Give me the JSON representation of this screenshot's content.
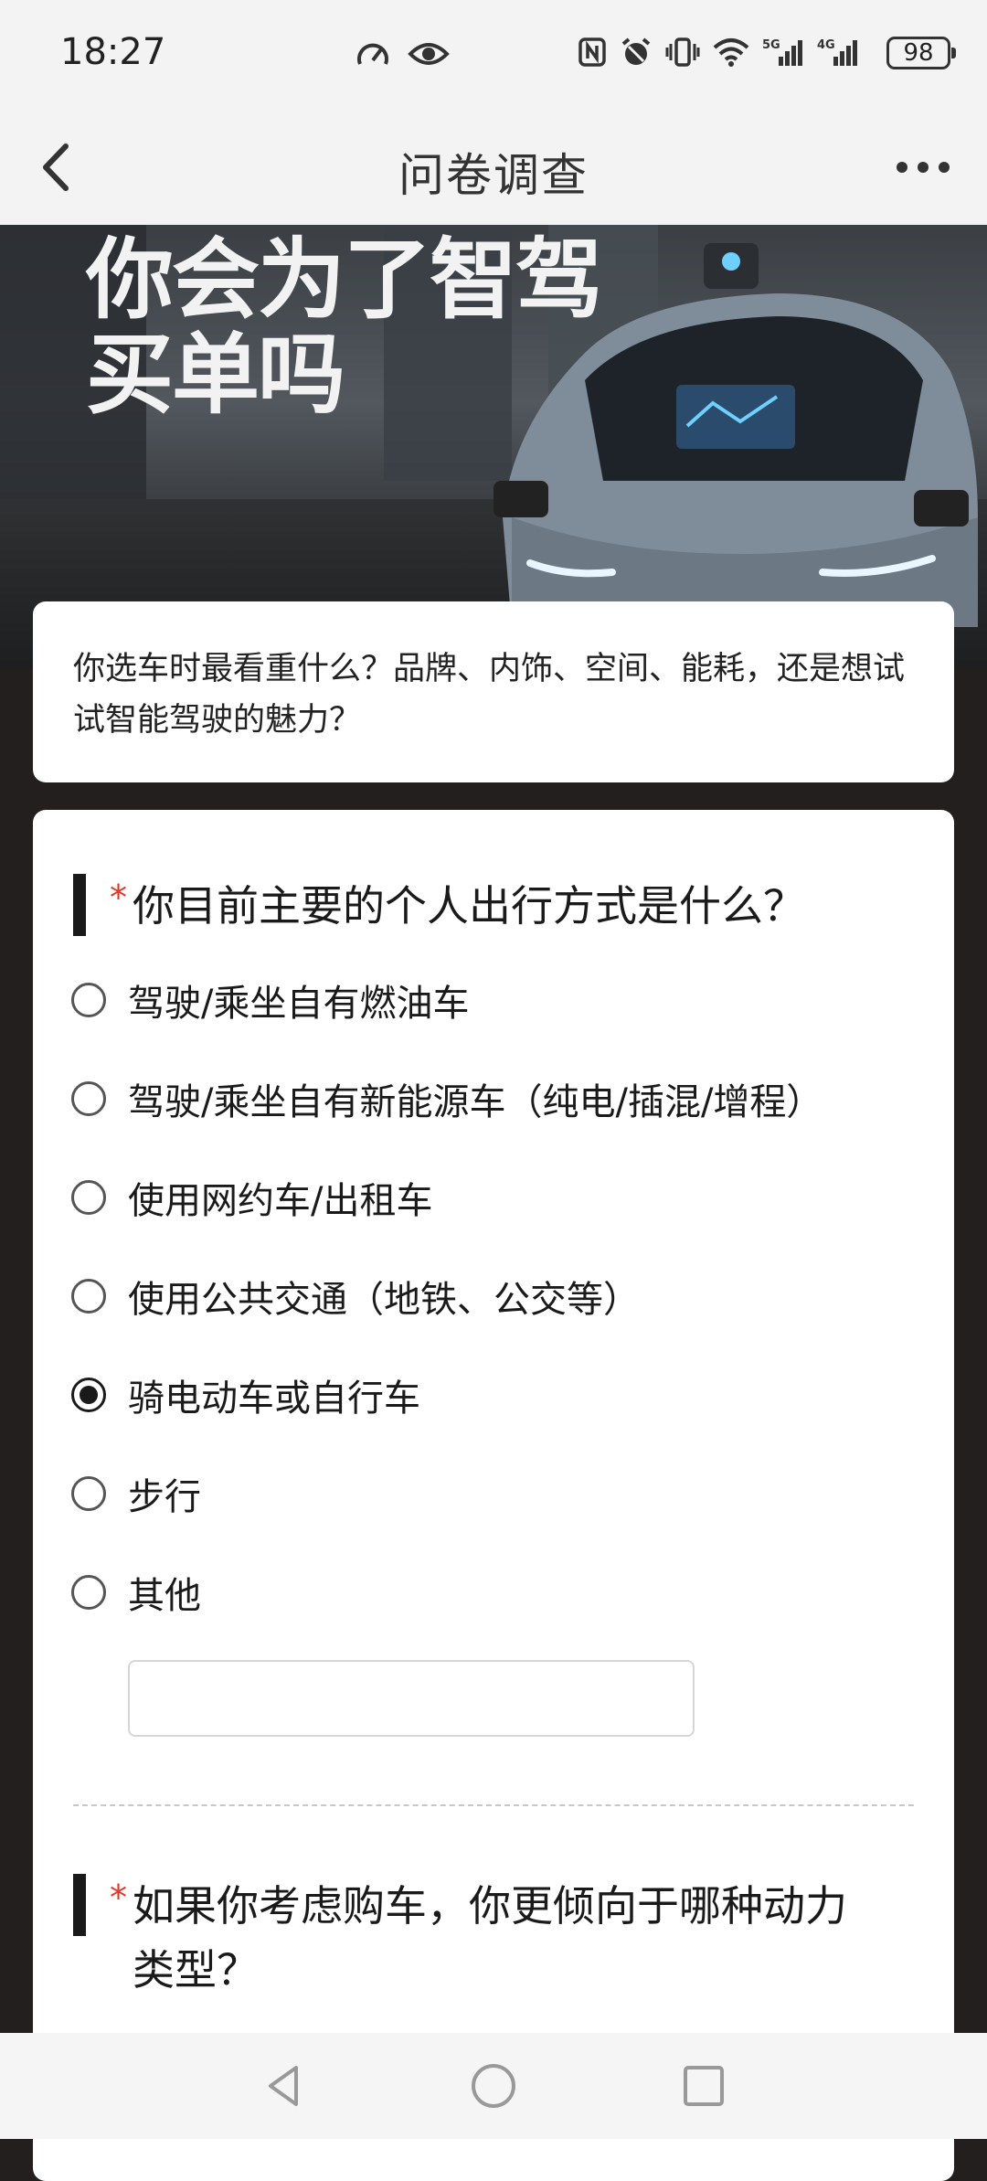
{
  "status_bar": {
    "time": "18:27",
    "battery": "98",
    "icons": [
      "speedometer-icon",
      "eye-icon",
      "nfc-icon",
      "alarm-icon",
      "vibrate-icon",
      "wifi-icon",
      "signal-5g-icon",
      "signal-4g-icon"
    ]
  },
  "header": {
    "title": "问卷调查",
    "back_icon": "chevron-left-icon",
    "more_icon": "more-horizontal-icon"
  },
  "banner": {
    "headline_line1": "你会为了智驾",
    "headline_line2": "买单吗"
  },
  "description": "你选车时最看重什么？品牌、内饰、空间、能耗，还是想试试智能驾驶的魅力？",
  "questions": [
    {
      "required_mark": "*",
      "title": "你目前主要的个人出行方式是什么？",
      "options": [
        {
          "label": "驾驶/乘坐自有燃油车",
          "checked": false
        },
        {
          "label": "驾驶/乘坐自有新能源车（纯电/插混/增程）",
          "checked": false
        },
        {
          "label": "使用网约车/出租车",
          "checked": false
        },
        {
          "label": "使用公共交通（地铁、公交等）",
          "checked": false
        },
        {
          "label": "骑电动车或自行车",
          "checked": true
        },
        {
          "label": "步行",
          "checked": false
        },
        {
          "label": "其他",
          "checked": false
        }
      ],
      "other_input_value": ""
    },
    {
      "required_mark": "*",
      "title_line1": "如果你考虑购车，你更倾向于哪种动力",
      "title_line2": "类型？"
    }
  ],
  "colors": {
    "required": "#e0392b",
    "page_background": "#231f1f",
    "card": "#ffffff"
  }
}
